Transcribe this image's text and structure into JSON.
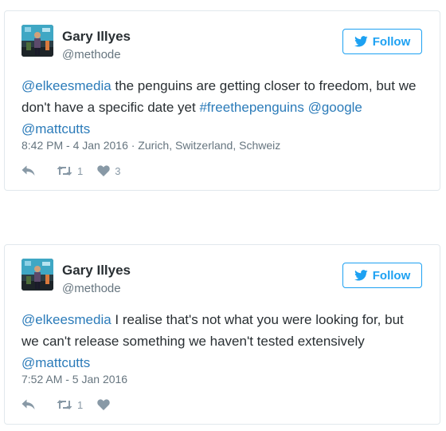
{
  "tweets": [
    {
      "author_name": "Gary Illyes",
      "author_handle": "@methode",
      "follow_label": "Follow",
      "text": {
        "mention1": "@elkeesmedia",
        "body1": " the penguins are getting closer to freedom, but we don't have a specific date yet ",
        "hashtag": "#freethepenguins",
        "space1": " ",
        "mention2": "@google",
        "space2": " ",
        "mention3": "@mattcutts"
      },
      "meta": "8:42 PM - 4 Jan 2016 · Zurich, Switzerland, Schweiz",
      "retweets": "1",
      "likes": "3"
    },
    {
      "author_name": "Gary Illyes",
      "author_handle": "@methode",
      "follow_label": "Follow",
      "text": {
        "mention1": "@elkeesmedia",
        "body1": " I realise that's not what you were looking for, but we can't release something we haven't tested extensively ",
        "mention2": "@mattcutts"
      },
      "meta": "7:52 AM - 5 Jan 2016",
      "retweets": "1",
      "likes": ""
    }
  ],
  "colors": {
    "link": "#2b7bb9",
    "follow": "#1da1f2",
    "text": "#292f33",
    "muted": "#66757f",
    "icon": "#8899a6"
  },
  "icons": [
    "twitter-bird-icon",
    "reply-icon",
    "retweet-icon",
    "heart-icon"
  ]
}
